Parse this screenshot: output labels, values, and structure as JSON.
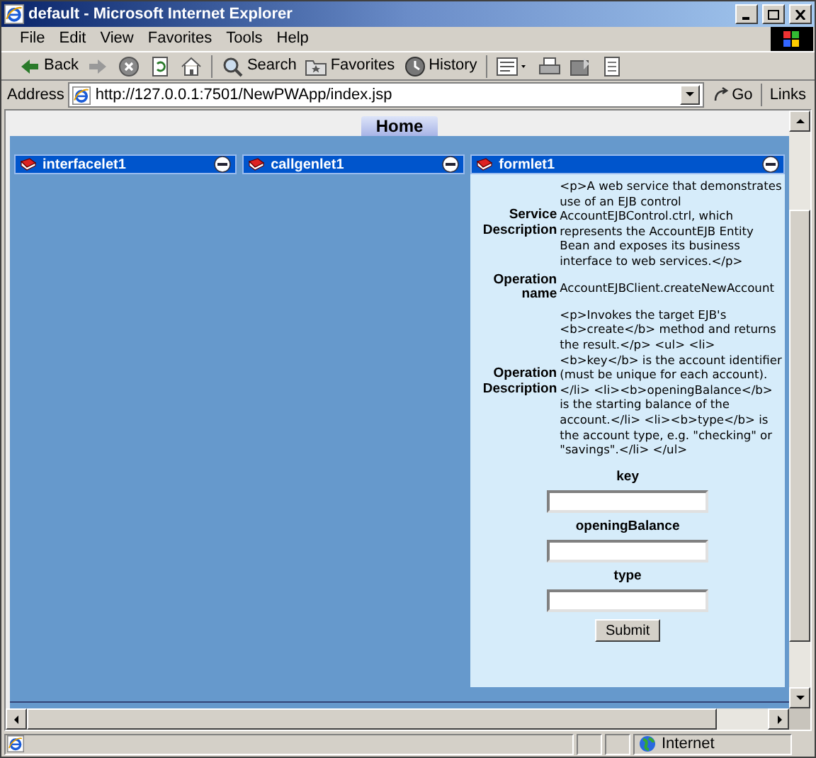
{
  "window": {
    "title": "default - Microsoft Internet Explorer"
  },
  "menu": [
    "File",
    "Edit",
    "View",
    "Favorites",
    "Tools",
    "Help"
  ],
  "toolbar": [
    {
      "kind": "back",
      "label": "Back"
    },
    {
      "kind": "forward"
    },
    {
      "kind": "stop"
    },
    {
      "kind": "refresh"
    },
    {
      "kind": "home"
    },
    {
      "kind": "search",
      "label": "Search"
    },
    {
      "kind": "favorites",
      "label": "Favorites"
    },
    {
      "kind": "history",
      "label": "History"
    },
    {
      "kind": "mail"
    },
    {
      "kind": "print"
    },
    {
      "kind": "edit"
    },
    {
      "kind": "discuss"
    }
  ],
  "address": {
    "label": "Address",
    "url": "http://127.0.0.1:7501/NewPWApp/index.jsp",
    "go": "Go",
    "links": "Links"
  },
  "page_tab": "Home",
  "portlets": [
    {
      "title": "interfacelet1"
    },
    {
      "title": "callgenlet1"
    },
    {
      "title": "formlet1"
    }
  ],
  "form": {
    "rows": [
      {
        "label": "Service Description",
        "value": "<p>A web service that demonstrates use of an EJB control AccountEJBControl.ctrl, which represents the AccountEJB Entity Bean and exposes its business interface to web services.</p>"
      },
      {
        "label": "Operation name",
        "value": "AccountEJBClient.createNewAccount"
      },
      {
        "label": "Operation Description",
        "value": "<p>Invokes the target EJB's <b>create</b> method and returns the result.</p> <ul> <li><b>key</b> is the account identifier (must be unique for each account).</li> <li><b>openingBalance</b> is the starting balance of the account.</li> <li><b>type</b> is the account type, e.g. \"checking\" or \"savings\".</li> </ul>"
      }
    ],
    "fields": [
      {
        "label": "key"
      },
      {
        "label": "openingBalance"
      },
      {
        "label": "type"
      }
    ],
    "submit": "Submit"
  },
  "status": {
    "zone": "Internet"
  }
}
